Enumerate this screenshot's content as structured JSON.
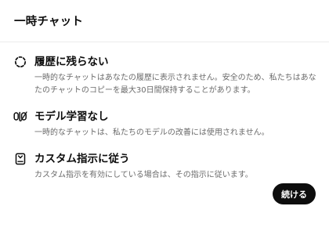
{
  "dialog": {
    "title": "一時チャット",
    "features": [
      {
        "icon": "dashed-circle-icon",
        "title": "履歴に残らない",
        "description": "一時的なチャットはあなたの履歴に表示されません。安全のため、私たちはあなたのチャットのコピーを最大30日間保持することがあります。"
      },
      {
        "icon": "no-memory-icon",
        "title": "モデル学習なし",
        "description": "一時的なチャットは、私たちのモデルの改善には使用されません。"
      },
      {
        "icon": "custom-instructions-icon",
        "title": "カスタム指示に従う",
        "description": "カスタム指示を有効にしている場合は、その指示に従います。"
      }
    ],
    "continue_label": "続ける"
  }
}
